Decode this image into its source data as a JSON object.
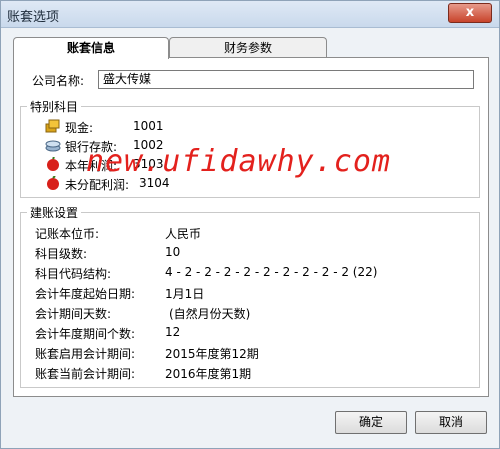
{
  "window": {
    "title": "账套选项",
    "close_label": "x"
  },
  "tabs": [
    {
      "label": "账套信息"
    },
    {
      "label": "财务参数"
    }
  ],
  "company": {
    "label": "公司名称:",
    "value": "盛大传媒"
  },
  "special_accounts": {
    "title": "特别科目",
    "items": [
      {
        "label": "现金:",
        "code": "1001",
        "icon": "cash-icon"
      },
      {
        "label": "银行存款:",
        "code": "1002",
        "icon": "bank-icon"
      },
      {
        "label": "本年利润:",
        "code": "3103",
        "icon": "profit-icon"
      },
      {
        "label": "未分配利润:",
        "code": "3104",
        "icon": "apple-icon"
      }
    ]
  },
  "watermark": "new.ufidawhy.com",
  "setup": {
    "title": "建账设置",
    "rows": [
      {
        "label": "记账本位币:",
        "value": "人民币"
      },
      {
        "label": "科目级数:",
        "value": "10"
      },
      {
        "label": "科目代码结构:",
        "value": "4 - 2 - 2 - 2 - 2 - 2 - 2 - 2 - 2 - 2  (22)"
      },
      {
        "label": "会计年度起始日期:",
        "value": "1月1日"
      },
      {
        "label": "会计期间天数:",
        "value": "(自然月份天数)"
      },
      {
        "label": "会计年度期间个数:",
        "value": "12"
      },
      {
        "label": "账套启用会计期间:",
        "value": "2015年度第12期"
      },
      {
        "label": "账套当前会计期间:",
        "value": "2016年度第1期"
      }
    ]
  },
  "buttons": {
    "ok": "确定",
    "cancel": "取消"
  }
}
